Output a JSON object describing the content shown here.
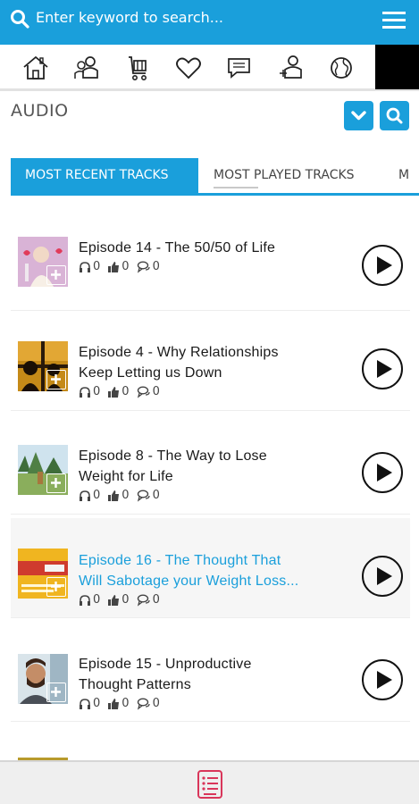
{
  "search": {
    "placeholder": "Enter keyword to search..."
  },
  "section": {
    "title": "AUDIO"
  },
  "tabs": [
    {
      "label": "MOST RECENT TRACKS",
      "active": true
    },
    {
      "label": "MOST PLAYED TRACKS",
      "active": false
    },
    {
      "label": "M",
      "active": false
    }
  ],
  "nav_icons": [
    "home-icon",
    "users-icon",
    "cart-icon",
    "heart-icon",
    "chat-icon",
    "user-group-icon",
    "globe-icon"
  ],
  "tracks": [
    {
      "title_line1": "Episode 14 - The 50/50 of Life",
      "title_line2": "",
      "listens": "0",
      "likes": "0",
      "comments": "0",
      "highlight": false
    },
    {
      "title_line1": "Episode 4 - Why Relationships",
      "title_line2": "Keep Letting us Down",
      "listens": "0",
      "likes": "0",
      "comments": "0",
      "highlight": false
    },
    {
      "title_line1": "Episode 8 - The Way to Lose",
      "title_line2": "Weight for Life",
      "listens": "0",
      "likes": "0",
      "comments": "0",
      "highlight": false
    },
    {
      "title_line1": "Episode 16 - The Thought That",
      "title_line2": "Will Sabotage your Weight Loss...",
      "listens": "0",
      "likes": "0",
      "comments": "0",
      "highlight": true
    },
    {
      "title_line1": "Episode 15 - Unproductive",
      "title_line2": "Thought Patterns",
      "listens": "0",
      "likes": "0",
      "comments": "0",
      "highlight": false
    }
  ],
  "colors": {
    "accent": "#1a9fdb",
    "bottom_icon": "#d9365a"
  }
}
